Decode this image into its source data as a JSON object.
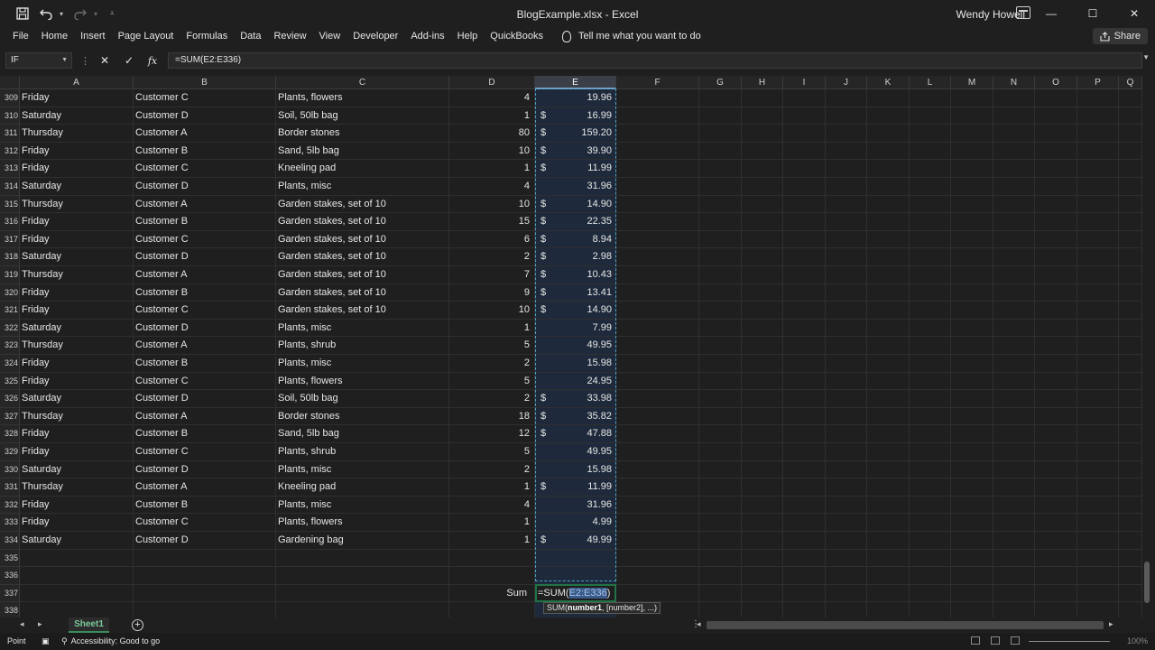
{
  "window": {
    "title": "BlogExample.xlsx  -  Excel",
    "user": "Wendy Howell"
  },
  "menu": {
    "tabs": [
      "File",
      "Home",
      "Insert",
      "Page Layout",
      "Formulas",
      "Data",
      "Review",
      "View",
      "Developer",
      "Add-ins",
      "Help",
      "QuickBooks"
    ],
    "tell_me": "Tell me what you want to do",
    "share": "Share"
  },
  "formula_bar": {
    "name_box": "IF",
    "formula": "=SUM(E2:E336)"
  },
  "columns": [
    "A",
    "B",
    "C",
    "D",
    "E",
    "F",
    "G",
    "H",
    "I",
    "J",
    "K",
    "L",
    "M",
    "N",
    "O",
    "P",
    "Q"
  ],
  "selected_column": "E",
  "rows": [
    {
      "n": "309",
      "day": "Friday",
      "customer": "Customer C",
      "item": "Plants, flowers",
      "qty": "4",
      "dollar": "",
      "amount": "19.96"
    },
    {
      "n": "310",
      "day": "Saturday",
      "customer": "Customer D",
      "item": "Soil, 50lb bag",
      "qty": "1",
      "dollar": "$",
      "amount": "16.99"
    },
    {
      "n": "311",
      "day": "Thursday",
      "customer": "Customer A",
      "item": "Border stones",
      "qty": "80",
      "dollar": "$",
      "amount": "159.20"
    },
    {
      "n": "312",
      "day": "Friday",
      "customer": "Customer B",
      "item": "Sand, 5lb bag",
      "qty": "10",
      "dollar": "$",
      "amount": "39.90"
    },
    {
      "n": "313",
      "day": "Friday",
      "customer": "Customer C",
      "item": "Kneeling pad",
      "qty": "1",
      "dollar": "$",
      "amount": "11.99"
    },
    {
      "n": "314",
      "day": "Saturday",
      "customer": "Customer D",
      "item": "Plants, misc",
      "qty": "4",
      "dollar": "",
      "amount": "31.96"
    },
    {
      "n": "315",
      "day": "Thursday",
      "customer": "Customer A",
      "item": "Garden stakes, set of 10",
      "qty": "10",
      "dollar": "$",
      "amount": "14.90"
    },
    {
      "n": "316",
      "day": "Friday",
      "customer": "Customer B",
      "item": "Garden stakes, set of 10",
      "qty": "15",
      "dollar": "$",
      "amount": "22.35"
    },
    {
      "n": "317",
      "day": "Friday",
      "customer": "Customer C",
      "item": "Garden stakes, set of 10",
      "qty": "6",
      "dollar": "$",
      "amount": "8.94"
    },
    {
      "n": "318",
      "day": "Saturday",
      "customer": "Customer D",
      "item": "Garden stakes, set of 10",
      "qty": "2",
      "dollar": "$",
      "amount": "2.98"
    },
    {
      "n": "319",
      "day": "Thursday",
      "customer": "Customer A",
      "item": "Garden stakes, set of 10",
      "qty": "7",
      "dollar": "$",
      "amount": "10.43"
    },
    {
      "n": "320",
      "day": "Friday",
      "customer": "Customer B",
      "item": "Garden stakes, set of 10",
      "qty": "9",
      "dollar": "$",
      "amount": "13.41"
    },
    {
      "n": "321",
      "day": "Friday",
      "customer": "Customer C",
      "item": "Garden stakes, set of 10",
      "qty": "10",
      "dollar": "$",
      "amount": "14.90"
    },
    {
      "n": "322",
      "day": "Saturday",
      "customer": "Customer D",
      "item": "Plants, misc",
      "qty": "1",
      "dollar": "",
      "amount": "7.99"
    },
    {
      "n": "323",
      "day": "Thursday",
      "customer": "Customer A",
      "item": "Plants, shrub",
      "qty": "5",
      "dollar": "",
      "amount": "49.95"
    },
    {
      "n": "324",
      "day": "Friday",
      "customer": "Customer B",
      "item": "Plants, misc",
      "qty": "2",
      "dollar": "",
      "amount": "15.98"
    },
    {
      "n": "325",
      "day": "Friday",
      "customer": "Customer C",
      "item": "Plants, flowers",
      "qty": "5",
      "dollar": "",
      "amount": "24.95"
    },
    {
      "n": "326",
      "day": "Saturday",
      "customer": "Customer D",
      "item": "Soil, 50lb bag",
      "qty": "2",
      "dollar": "$",
      "amount": "33.98"
    },
    {
      "n": "327",
      "day": "Thursday",
      "customer": "Customer A",
      "item": "Border stones",
      "qty": "18",
      "dollar": "$",
      "amount": "35.82"
    },
    {
      "n": "328",
      "day": "Friday",
      "customer": "Customer B",
      "item": "Sand, 5lb bag",
      "qty": "12",
      "dollar": "$",
      "amount": "47.88"
    },
    {
      "n": "329",
      "day": "Friday",
      "customer": "Customer C",
      "item": "Plants, shrub",
      "qty": "5",
      "dollar": "",
      "amount": "49.95"
    },
    {
      "n": "330",
      "day": "Saturday",
      "customer": "Customer D",
      "item": "Plants, misc",
      "qty": "2",
      "dollar": "",
      "amount": "15.98"
    },
    {
      "n": "331",
      "day": "Thursday",
      "customer": "Customer A",
      "item": "Kneeling pad",
      "qty": "1",
      "dollar": "$",
      "amount": "11.99"
    },
    {
      "n": "332",
      "day": "Friday",
      "customer": "Customer B",
      "item": "Plants, misc",
      "qty": "4",
      "dollar": "",
      "amount": "31.96"
    },
    {
      "n": "333",
      "day": "Friday",
      "customer": "Customer C",
      "item": "Plants, flowers",
      "qty": "1",
      "dollar": "",
      "amount": "4.99"
    },
    {
      "n": "334",
      "day": "Saturday",
      "customer": "Customer D",
      "item": "Gardening bag",
      "qty": "1",
      "dollar": "$",
      "amount": "49.99"
    },
    {
      "n": "335",
      "day": "",
      "customer": "",
      "item": "",
      "qty": "",
      "dollar": "",
      "amount": ""
    },
    {
      "n": "336",
      "day": "",
      "customer": "",
      "item": "",
      "qty": "",
      "dollar": "",
      "amount": ""
    }
  ],
  "sum_row": {
    "n": "337",
    "label": "Sum",
    "edit_prefix": "=SUM(",
    "edit_ref": "E2:E336",
    "edit_suffix": ")"
  },
  "last_row": "338",
  "tooltip": {
    "prefix": "SUM(",
    "bold": "number1",
    "rest": ", [number2], ...)"
  },
  "sheet": {
    "active_tab": "Sheet1"
  },
  "status": {
    "mode": "Point",
    "accessibility": "Accessibility: Good to go",
    "zoom": "100%"
  },
  "colors": {
    "accent_green": "#217346",
    "selection_fill": "#1e2a3b",
    "marquee": "#4aa3c8"
  }
}
